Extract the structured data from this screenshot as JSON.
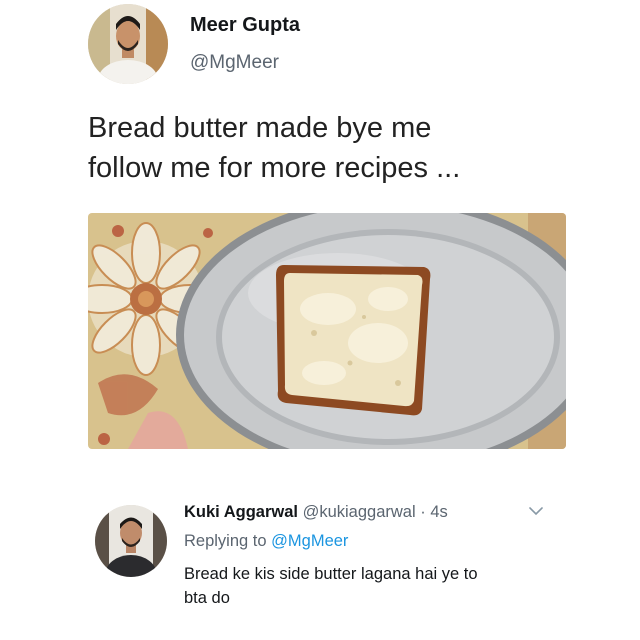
{
  "tweet": {
    "author_name": "Meer Gupta",
    "author_handle": "@MgMeer",
    "text_line1": "Bread butter made bye me",
    "text_line2": "follow me for more recipes ..."
  },
  "reply": {
    "author_name": "Kuki Aggarwal",
    "author_handle": "@kukiaggarwal",
    "separator": "·",
    "time": "4s",
    "replying_prefix": "Replying to",
    "replying_to": "@MgMeer",
    "text_line1": "Bread ke kis side butter lagana hai ye to",
    "text_line2": "bta do"
  },
  "colors": {
    "link": "#1b95e0",
    "secondary_text": "#5b6570"
  }
}
